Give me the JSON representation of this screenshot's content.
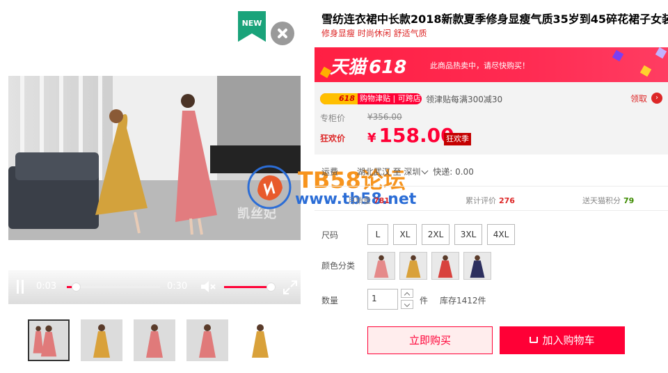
{
  "badge": {
    "new_label": "NEW",
    "badge_color": "#1aa37a"
  },
  "video": {
    "brand_watermark": "凯丝妃",
    "current_time": "0:03",
    "duration": "0:30",
    "progress_fraction": 0.1,
    "volume_fraction": 0.95,
    "accent_color": "#ff0036"
  },
  "thumbnails": [
    {
      "name": "thumb-1",
      "dress_color": "#e07a7a",
      "selected": true
    },
    {
      "name": "thumb-2",
      "dress_color": "#d9a13a",
      "selected": false
    },
    {
      "name": "thumb-3",
      "dress_color": "#e07a7a",
      "selected": false
    },
    {
      "name": "thumb-4",
      "dress_color": "#e07a7a",
      "selected": false
    },
    {
      "name": "thumb-5",
      "dress_color": "#d9a13a",
      "selected": false
    }
  ],
  "overlay": {
    "title": "TB58论坛",
    "url": "www.tb58.net"
  },
  "product": {
    "title": "雪纺连衣裙中长款2018新款夏季修身显瘦气质35岁到45碎花裙子女装",
    "subtitle": "修身显瘦 时尚休闲 舒适气质"
  },
  "promo": {
    "logo_text": "天猫",
    "logo_number": "618",
    "message": "此商品热卖中，请尽快购买！"
  },
  "price": {
    "allowance_badge_618": "618",
    "allowance_badge_label": "购物津贴 | 可跨店",
    "allowance_text": "领津贴每满300减30",
    "claim_label": "领取",
    "claim_icon": "›",
    "original_label": "专柜价",
    "original_price": "¥356.00",
    "sale_label": "狂欢价",
    "currency": "¥",
    "sale_price": "158.00",
    "sale_tag": "狂欢季"
  },
  "shipping": {
    "label": "运费",
    "from": "湖北武汉",
    "to_word": "至",
    "to": "深圳",
    "express": "快递: 0.00"
  },
  "stats": {
    "monthly_sales_label": "月销量",
    "monthly_sales": "781",
    "reviews_label": "累计评价",
    "reviews": "276",
    "points_label": "送天猫积分",
    "points": "79"
  },
  "sizes": {
    "label": "尺码",
    "options": [
      "L",
      "XL",
      "2XL",
      "3XL",
      "4XL"
    ]
  },
  "colors": {
    "label": "颜色分类",
    "options": [
      {
        "name": "pink-floral",
        "color": "#e58a8a"
      },
      {
        "name": "yellow-floral",
        "color": "#d9a13a"
      },
      {
        "name": "red-floral",
        "color": "#d8423e"
      },
      {
        "name": "navy-floral",
        "color": "#2c2f5e"
      }
    ]
  },
  "quantity": {
    "label": "数量",
    "value": "1",
    "unit": "件",
    "stock": "库存1412件"
  },
  "actions": {
    "buy_now": "立即购买",
    "add_to_cart": "加入购物车"
  }
}
